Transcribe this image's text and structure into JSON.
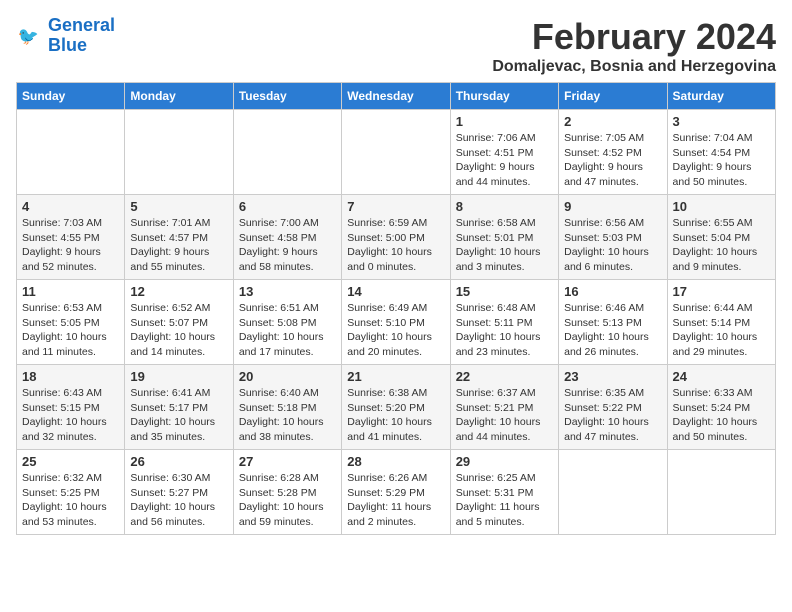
{
  "header": {
    "logo_line1": "General",
    "logo_line2": "Blue",
    "month_title": "February 2024",
    "subtitle": "Domaljevac, Bosnia and Herzegovina"
  },
  "days_of_week": [
    "Sunday",
    "Monday",
    "Tuesday",
    "Wednesday",
    "Thursday",
    "Friday",
    "Saturday"
  ],
  "weeks": [
    [
      {
        "day": "",
        "info": ""
      },
      {
        "day": "",
        "info": ""
      },
      {
        "day": "",
        "info": ""
      },
      {
        "day": "",
        "info": ""
      },
      {
        "day": "1",
        "info": "Sunrise: 7:06 AM\nSunset: 4:51 PM\nDaylight: 9 hours\nand 44 minutes."
      },
      {
        "day": "2",
        "info": "Sunrise: 7:05 AM\nSunset: 4:52 PM\nDaylight: 9 hours\nand 47 minutes."
      },
      {
        "day": "3",
        "info": "Sunrise: 7:04 AM\nSunset: 4:54 PM\nDaylight: 9 hours\nand 50 minutes."
      }
    ],
    [
      {
        "day": "4",
        "info": "Sunrise: 7:03 AM\nSunset: 4:55 PM\nDaylight: 9 hours\nand 52 minutes."
      },
      {
        "day": "5",
        "info": "Sunrise: 7:01 AM\nSunset: 4:57 PM\nDaylight: 9 hours\nand 55 minutes."
      },
      {
        "day": "6",
        "info": "Sunrise: 7:00 AM\nSunset: 4:58 PM\nDaylight: 9 hours\nand 58 minutes."
      },
      {
        "day": "7",
        "info": "Sunrise: 6:59 AM\nSunset: 5:00 PM\nDaylight: 10 hours\nand 0 minutes."
      },
      {
        "day": "8",
        "info": "Sunrise: 6:58 AM\nSunset: 5:01 PM\nDaylight: 10 hours\nand 3 minutes."
      },
      {
        "day": "9",
        "info": "Sunrise: 6:56 AM\nSunset: 5:03 PM\nDaylight: 10 hours\nand 6 minutes."
      },
      {
        "day": "10",
        "info": "Sunrise: 6:55 AM\nSunset: 5:04 PM\nDaylight: 10 hours\nand 9 minutes."
      }
    ],
    [
      {
        "day": "11",
        "info": "Sunrise: 6:53 AM\nSunset: 5:05 PM\nDaylight: 10 hours\nand 11 minutes."
      },
      {
        "day": "12",
        "info": "Sunrise: 6:52 AM\nSunset: 5:07 PM\nDaylight: 10 hours\nand 14 minutes."
      },
      {
        "day": "13",
        "info": "Sunrise: 6:51 AM\nSunset: 5:08 PM\nDaylight: 10 hours\nand 17 minutes."
      },
      {
        "day": "14",
        "info": "Sunrise: 6:49 AM\nSunset: 5:10 PM\nDaylight: 10 hours\nand 20 minutes."
      },
      {
        "day": "15",
        "info": "Sunrise: 6:48 AM\nSunset: 5:11 PM\nDaylight: 10 hours\nand 23 minutes."
      },
      {
        "day": "16",
        "info": "Sunrise: 6:46 AM\nSunset: 5:13 PM\nDaylight: 10 hours\nand 26 minutes."
      },
      {
        "day": "17",
        "info": "Sunrise: 6:44 AM\nSunset: 5:14 PM\nDaylight: 10 hours\nand 29 minutes."
      }
    ],
    [
      {
        "day": "18",
        "info": "Sunrise: 6:43 AM\nSunset: 5:15 PM\nDaylight: 10 hours\nand 32 minutes."
      },
      {
        "day": "19",
        "info": "Sunrise: 6:41 AM\nSunset: 5:17 PM\nDaylight: 10 hours\nand 35 minutes."
      },
      {
        "day": "20",
        "info": "Sunrise: 6:40 AM\nSunset: 5:18 PM\nDaylight: 10 hours\nand 38 minutes."
      },
      {
        "day": "21",
        "info": "Sunrise: 6:38 AM\nSunset: 5:20 PM\nDaylight: 10 hours\nand 41 minutes."
      },
      {
        "day": "22",
        "info": "Sunrise: 6:37 AM\nSunset: 5:21 PM\nDaylight: 10 hours\nand 44 minutes."
      },
      {
        "day": "23",
        "info": "Sunrise: 6:35 AM\nSunset: 5:22 PM\nDaylight: 10 hours\nand 47 minutes."
      },
      {
        "day": "24",
        "info": "Sunrise: 6:33 AM\nSunset: 5:24 PM\nDaylight: 10 hours\nand 50 minutes."
      }
    ],
    [
      {
        "day": "25",
        "info": "Sunrise: 6:32 AM\nSunset: 5:25 PM\nDaylight: 10 hours\nand 53 minutes."
      },
      {
        "day": "26",
        "info": "Sunrise: 6:30 AM\nSunset: 5:27 PM\nDaylight: 10 hours\nand 56 minutes."
      },
      {
        "day": "27",
        "info": "Sunrise: 6:28 AM\nSunset: 5:28 PM\nDaylight: 10 hours\nand 59 minutes."
      },
      {
        "day": "28",
        "info": "Sunrise: 6:26 AM\nSunset: 5:29 PM\nDaylight: 11 hours\nand 2 minutes."
      },
      {
        "day": "29",
        "info": "Sunrise: 6:25 AM\nSunset: 5:31 PM\nDaylight: 11 hours\nand 5 minutes."
      },
      {
        "day": "",
        "info": ""
      },
      {
        "day": "",
        "info": ""
      }
    ]
  ]
}
